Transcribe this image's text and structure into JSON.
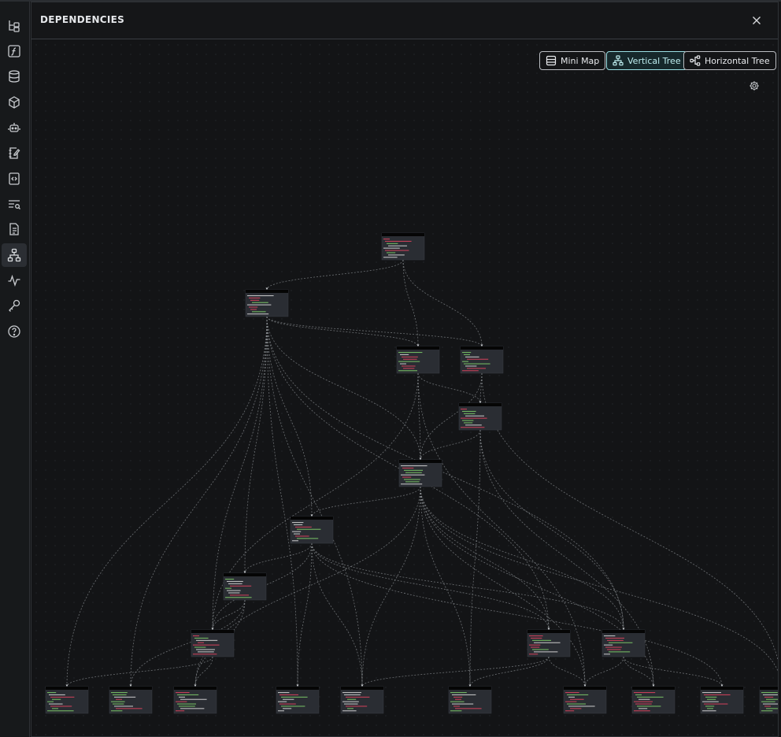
{
  "panel": {
    "title": "DEPENDENCIES",
    "close_icon": "close-icon"
  },
  "toolbar": {
    "mini_map_label": "Mini Map",
    "vertical_tree_label": "Vertical Tree",
    "horizontal_tree_label": "Horizontal Tree",
    "active": "vertical_tree",
    "settings_icon": "gear-icon"
  },
  "sidebar": {
    "items": [
      {
        "icon": "tree-structure-icon"
      },
      {
        "icon": "function-icon"
      },
      {
        "icon": "database-icon"
      },
      {
        "icon": "cube-icon"
      },
      {
        "icon": "robot-icon"
      },
      {
        "icon": "notebook-edit-icon"
      },
      {
        "icon": "code-file-icon"
      },
      {
        "icon": "text-search-icon"
      },
      {
        "icon": "document-icon"
      },
      {
        "icon": "dependency-tree-icon",
        "active": true
      },
      {
        "icon": "activity-icon"
      },
      {
        "icon": "key-icon"
      },
      {
        "icon": "help-icon"
      }
    ]
  },
  "colors": {
    "accent": "#9adfe3",
    "node_bg": "#2a2d33",
    "node_header": "#050505",
    "edge": "#8a8d92",
    "code_red": "#e0445f",
    "code_green": "#7fcf6a",
    "code_white": "#d8d8d8"
  }
}
